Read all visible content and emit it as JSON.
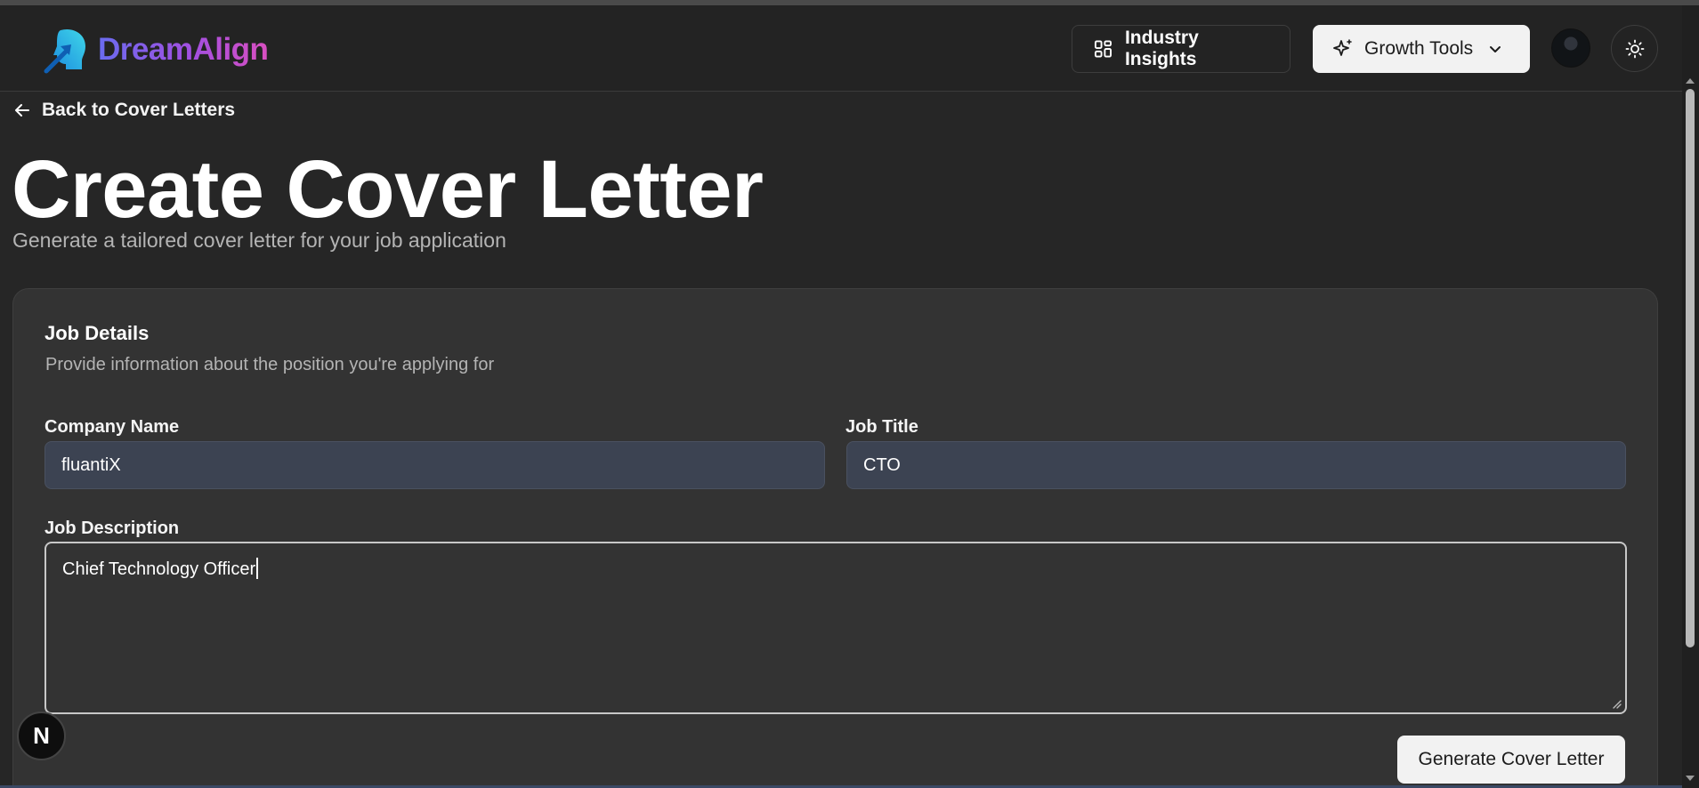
{
  "brand": {
    "name": "DreamAlign"
  },
  "header": {
    "insights_label": "Industry Insights",
    "growth_label": "Growth Tools"
  },
  "back_link": "Back to Cover Letters",
  "page": {
    "title": "Create Cover Letter",
    "subtitle": "Generate a tailored cover letter for your job application"
  },
  "card": {
    "title": "Job Details",
    "description": "Provide information about the position you're applying for",
    "company_label": "Company Name",
    "company_value": "fluantiX",
    "jobtitle_label": "Job Title",
    "jobtitle_value": "CTO",
    "description_label": "Job Description",
    "description_value": "Chief Technology Officer",
    "submit_label": "Generate Cover Letter"
  },
  "dev_badge": "N",
  "colors": {
    "background": "#262626",
    "card": "#333333",
    "input_fill": "#3c4352",
    "brand_gradient_start": "#6a6cf0",
    "brand_gradient_end": "#d94fc1",
    "logo_icon": "#2ec5e6"
  },
  "icons": [
    "logo-icon",
    "grid-icon",
    "sparkles-icon",
    "chevron-down-icon",
    "sun-icon",
    "arrow-left-icon"
  ]
}
